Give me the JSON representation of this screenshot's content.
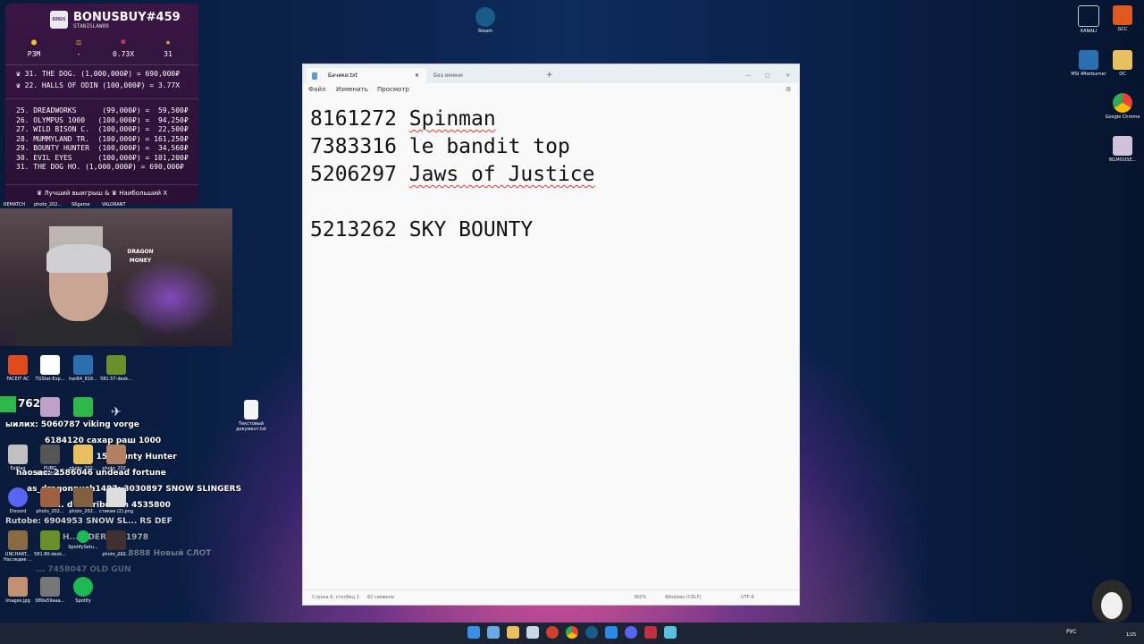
{
  "bonus_panel": {
    "title": "BONUSBUY#459",
    "subtitle": "STANISLAW89",
    "logo_text": "BONUS",
    "stats": [
      {
        "icon": "●",
        "value": "P3M",
        "color": "#f2c230"
      },
      {
        "icon": "⚖",
        "value": "-",
        "color": "#f2c230"
      },
      {
        "icon": "✖",
        "value": "0.73X",
        "color": "#e04050"
      },
      {
        "icon": "★",
        "value": "31",
        "color": "#f2c230"
      }
    ],
    "highlights": [
      "♛ 31. THE DOG. (1,000,000₽) = 690,000₽",
      "♛ 22. HALLS OF ODIN (100,000₽) = 3.77X"
    ],
    "entries": [
      "25. DREADWORKS      (99,000₽) =  59,500₽",
      "26. OLYMPUS 1000   (100,000₽) =  94,250₽",
      "27. WILD BISON C.  (100,000₽) =  22,500₽",
      "28. MUMMYLAND TR.  (100,000₽) = 161,250₽",
      "29. BOUNTY HUNTER  (100,000₽) =  34,560₽",
      "30. EVIL EYES      (100,000₽) = 101,200₽",
      "31. THE DOG HO. (1,000,000₽) = 690,000₽"
    ],
    "footer": "♛ Лучший выигрыш & ♛ Наибольший X"
  },
  "cam_sign": "DRAGON MONEY",
  "desktop_top": {
    "steam_label": "Steam"
  },
  "left_icon_row_labels": [
    "REMATCH",
    "photo_202...",
    "S6game",
    "VALORANT"
  ],
  "left_icons": [
    {
      "label": "FACEIT AC",
      "color": "#e04a1c"
    },
    {
      "label": "TGStat-Exp...",
      "color": "#ffffff"
    },
    {
      "label": "hwi64_816...",
      "color": "#2a6fb0"
    },
    {
      "label": "581.57-desk...",
      "color": "#6a8f2a"
    }
  ],
  "chat": [
    {
      "text": "762",
      "color": "#ffffff"
    },
    {
      "text": "ыилих: 5060787 viking vorge",
      "color": "#ffffff"
    },
    {
      "text": "6184120 сахар раш 1000",
      "color": "#ffffff"
    },
    {
      "text": "2... 15 Bounty Hunter",
      "color": "#ffffff"
    },
    {
      "text": "haosac: 2586046 undead fortune",
      "color": "#ffffff"
    },
    {
      "text": "as_dragonpush1487: 3030897 SNOW SLINGERS",
      "color": "#ffffff"
    },
    {
      "text": "f... d distribution 4535800",
      "color": "#ffffff"
    },
    {
      "text": "Rutobe: 6904953 SNOW SL... RS DEF",
      "color": "#ffffff"
    },
    {
      "text": "H... NDER 6871978",
      "color": "#ffffff"
    },
    {
      "text": "... 8888 Новый СЛОТ",
      "color": "#ffffff"
    },
    {
      "text": "... 7458047 OLD GUN",
      "color": "#ffffff"
    }
  ],
  "bottom_icons": [
    {
      "label": "Exitlag",
      "color": "#c0c0c0"
    },
    {
      "label": "PUBG BATTLEGR...",
      "color": "#555555"
    },
    {
      "label": "photo_202...",
      "color": "#e8c060"
    },
    {
      "label": "photo_202...",
      "color": "#b08060"
    },
    {
      "label": "Discord",
      "color": "#5865f2"
    },
    {
      "label": "photo_202...",
      "color": "#a06040"
    },
    {
      "label": "photo_202...",
      "color": "#806040"
    },
    {
      "label": "стикеи (2).png",
      "color": "#dddddd"
    },
    {
      "label": "UNCHART... Наследие ...",
      "color": "#8a6a40"
    },
    {
      "label": "581.80-desk...",
      "color": "#6a8f2a"
    },
    {
      "label": "SpotifySetu...",
      "color": "#1db954"
    },
    {
      "label": "photo_202...",
      "color": "#403030"
    },
    {
      "label": "images.jpg",
      "color": "#c09070"
    },
    {
      "label": "089a59aaa...",
      "color": "#777777"
    },
    {
      "label": "Spotify",
      "color": "#1db954"
    }
  ],
  "desktop_file": {
    "label": "Текстовый документ.txt"
  },
  "right_icons": [
    {
      "label": "KANALI",
      "color": "#cccccc"
    },
    {
      "label": "GCC",
      "color": "#e05a20"
    },
    {
      "label": "MSI Afterburner",
      "color": "#2a6fb0"
    },
    {
      "label": "OC",
      "color": "#e8c060"
    },
    {
      "label": "Google Chrome",
      "color": "#4285f4"
    },
    {
      "label": "WLMOUSE...",
      "color": "#d0c0d8"
    }
  ],
  "notepad": {
    "tabs": [
      {
        "label": "Бачики.txt",
        "active": true
      },
      {
        "label": "Без имени",
        "active": false
      }
    ],
    "menu": [
      "Файл",
      "Изменить",
      "Просмотр"
    ],
    "lines": [
      {
        "num": "8161272",
        "text": "Spinman",
        "squiggle": true
      },
      {
        "num": "7383316",
        "text": "le bandit top",
        "squiggle": false
      },
      {
        "num": "5206297",
        "text": "Jaws of Justice",
        "squiggle": true
      },
      {
        "num": "",
        "text": "",
        "squiggle": false
      },
      {
        "num": "5213262",
        "text": "SKY BOUNTY",
        "squiggle": false
      }
    ],
    "status": {
      "position": "Строка 6, столбец 1",
      "chars": "82 символа",
      "zoom": "360%",
      "line_ending": "Windows (CRLF)",
      "encoding": "UTF-8"
    }
  },
  "taskbar": {
    "lang": "РУС",
    "time": "",
    "date": "1/25"
  }
}
